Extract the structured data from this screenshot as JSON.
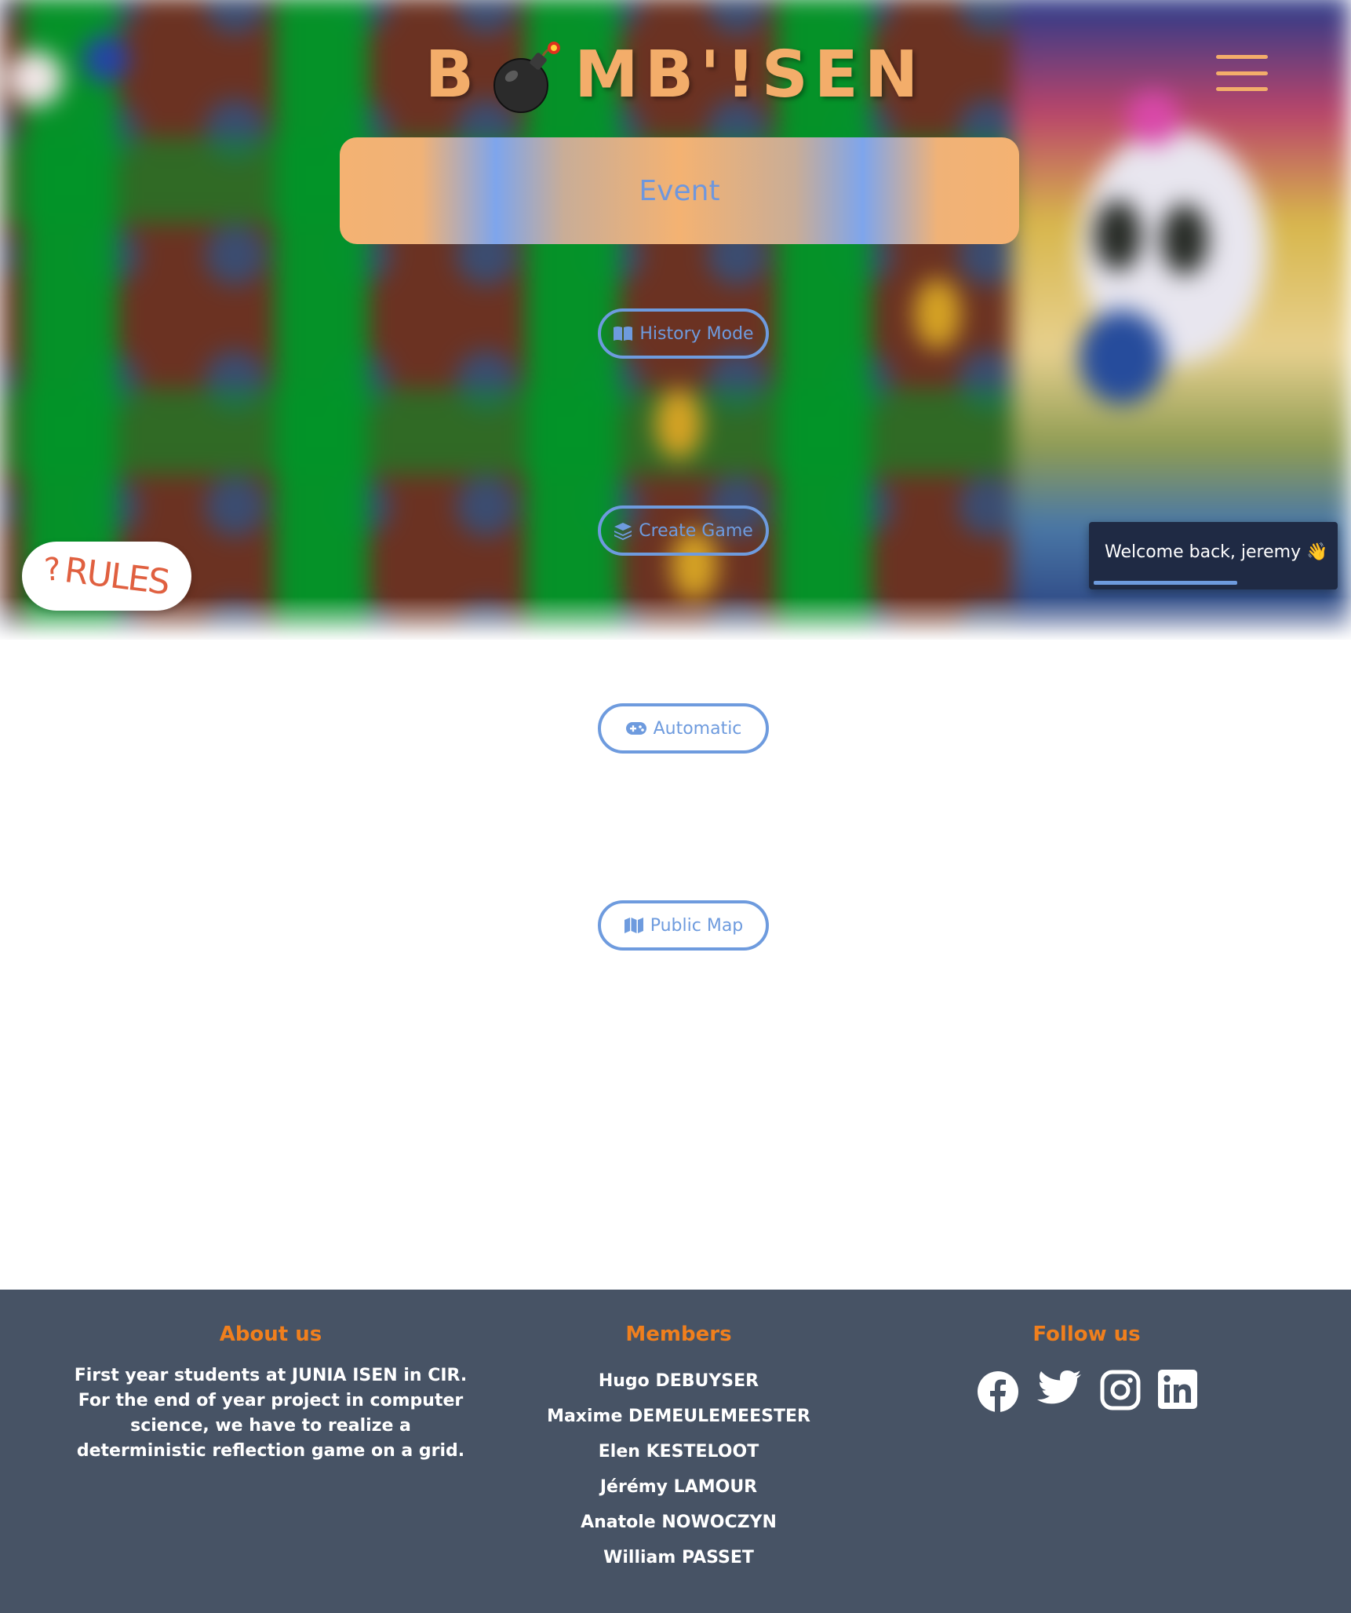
{
  "header": {
    "logo_text_left": "B",
    "logo_text_right": "MB'!SEN",
    "logo_icon": "bomb-icon",
    "menu_icon": "hamburger-menu-icon"
  },
  "event_banner": {
    "label": "Event"
  },
  "modes": {
    "history": {
      "label": "History Mode",
      "icon": "book-icon"
    },
    "create": {
      "label": "Create Game",
      "icon": "layers-icon"
    },
    "automatic": {
      "label": "Automatic",
      "icon": "gamepad-icon"
    },
    "public_map": {
      "label": "Public Map",
      "icon": "map-icon"
    }
  },
  "rules_button": {
    "question_mark": "?",
    "label": "RULES"
  },
  "toast": {
    "message": "Welcome back, jeremy 👋",
    "progress": 0.6
  },
  "footer": {
    "about": {
      "heading": "About us",
      "text": "First year students at JUNIA ISEN in CIR. For the end of year project in computer science, we have to realize a deterministic reflection game on a grid."
    },
    "members": {
      "heading": "Members",
      "names": [
        "Hugo DEBUYSER",
        "Maxime DEMEULEMEESTER",
        "Elen KESTELOOT",
        "Jérémy LAMOUR",
        "Anatole NOWOCZYN",
        "William PASSET"
      ]
    },
    "follow": {
      "heading": "Follow us",
      "icons": [
        "facebook-icon",
        "twitter-icon",
        "instagram-icon",
        "linkedin-icon"
      ]
    }
  },
  "colors": {
    "accent_orange": "#f3ad6a",
    "accent_blue": "#6e9bde",
    "footer_bg": "#475365",
    "footer_heading": "#f07f1d",
    "toast_bg": "#1f2a44"
  }
}
